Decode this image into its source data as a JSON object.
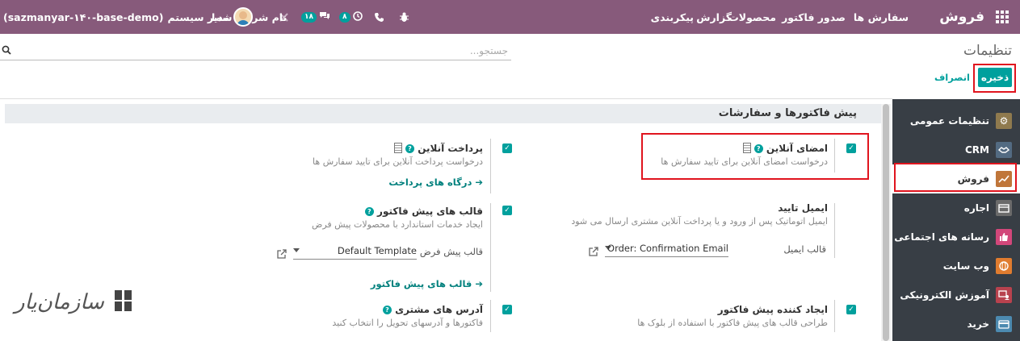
{
  "topbar": {
    "brand": "فروش",
    "menu": [
      "سفارش ها",
      "صدور فاکتور",
      "محصولات",
      "گزارش",
      "پیکربندی"
    ],
    "company": "نام شرکت شما",
    "messages_count": "۱۸",
    "activities_count": "۸",
    "user": "مدیر سیستم",
    "database": "(sazmanyar-۱۴۰-base-demo)",
    "bar_color": "#875a7b"
  },
  "control_panel": {
    "title": "تنظیمات",
    "search_placeholder": "جستجو...",
    "save_label": "ذخیره",
    "discard_label": "انصراف"
  },
  "sidebar": {
    "items": [
      {
        "label": "تنظیمات عمومی",
        "icon": "gear-icon",
        "color": "#8f7a4e"
      },
      {
        "label": "CRM",
        "icon": "handshake-icon",
        "color": "#536b82"
      },
      {
        "label": "فروش",
        "icon": "chart-up-icon",
        "color": "#c0763a",
        "active": true
      },
      {
        "label": "اجاره",
        "icon": "calendar-icon",
        "color": "#6b6b6b"
      },
      {
        "label": "رسانه های اجتماعی",
        "icon": "thumbs-up-icon",
        "color": "#d2477a"
      },
      {
        "label": "وب سایت",
        "icon": "globe-icon",
        "color": "#e07c2f"
      },
      {
        "label": "آموزش الکترونیکی",
        "icon": "elearning-icon",
        "color": "#b8424e"
      },
      {
        "label": "خرید",
        "icon": "credit-card-icon",
        "color": "#4c8ab0"
      }
    ]
  },
  "section": {
    "title": "پیش فاکتورها و سفارشات"
  },
  "settings": {
    "online_signature": {
      "title": "امضای آنلاین",
      "desc": "درخواست امضای آنلاین برای تایید سفارش ها"
    },
    "online_payment": {
      "title": "پرداخت آنلاین",
      "desc": "درخواست پرداخت آنلاین برای تایید سفارش ها",
      "link": "درگاه های پرداخت"
    },
    "confirmation_email": {
      "title": "ایمیل تایید",
      "desc": "ایمیل اتوماتیک پس از ورود و یا پرداخت آنلاین مشتری ارسال می شود",
      "field_label": "قالب ایمیل",
      "field_value": "Order: Confirmation Email"
    },
    "quotation_templates": {
      "title": "قالب های پیش فاکتور",
      "desc": "ایجاد خدمات استاندارد با محصولات پیش فرض",
      "field_label": "قالب پیش فرض",
      "field_value": "Default Template",
      "link": "قالب های پیش فاکتور"
    },
    "quotation_builder": {
      "title": "ایجاد کننده پیش فاکتور",
      "desc": "طراحی قالب های پیش فاکتور با استفاده از بلوک ها"
    },
    "customer_addresses": {
      "title": "آدرس های مشتری",
      "desc": "فاکتورها و آدرسهای تحویل را انتخاب کنید"
    }
  },
  "watermark": {
    "text": "سازمان‌یار"
  }
}
